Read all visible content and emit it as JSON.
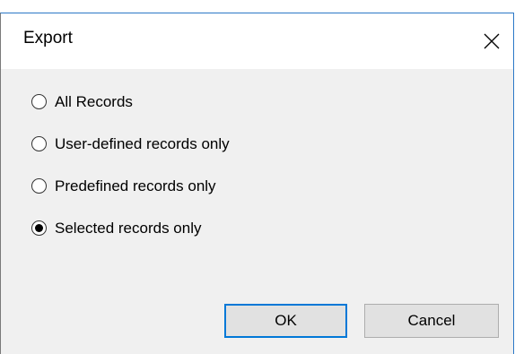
{
  "dialog": {
    "title": "Export",
    "close_icon": "close-icon"
  },
  "options": [
    {
      "label": "All Records",
      "selected": false
    },
    {
      "label": "User-defined records only",
      "selected": false
    },
    {
      "label": "Predefined records only",
      "selected": false
    },
    {
      "label": "Selected records only",
      "selected": true
    }
  ],
  "buttons": {
    "ok_label": "OK",
    "cancel_label": "Cancel"
  },
  "colors": {
    "accent": "#0078d7",
    "dialog_bg": "#f0f0f0",
    "titlebar_bg": "#ffffff"
  }
}
